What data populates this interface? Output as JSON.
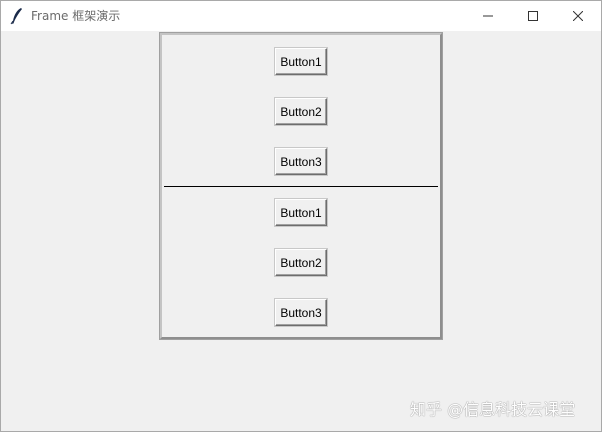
{
  "window": {
    "title": "Frame 框架演示",
    "controls": {
      "minimize": "minimize-icon",
      "maximize": "maximize-icon",
      "close": "close-icon"
    }
  },
  "frame": {
    "top_buttons": [
      "Button1",
      "Button2",
      "Button3"
    ],
    "bottom_buttons": [
      "Button1",
      "Button2",
      "Button3"
    ]
  },
  "watermark": "知乎 @信息科技云课堂",
  "colors": {
    "background": "#f0f0f0",
    "titlebar": "#ffffff",
    "divider": "#000000"
  }
}
